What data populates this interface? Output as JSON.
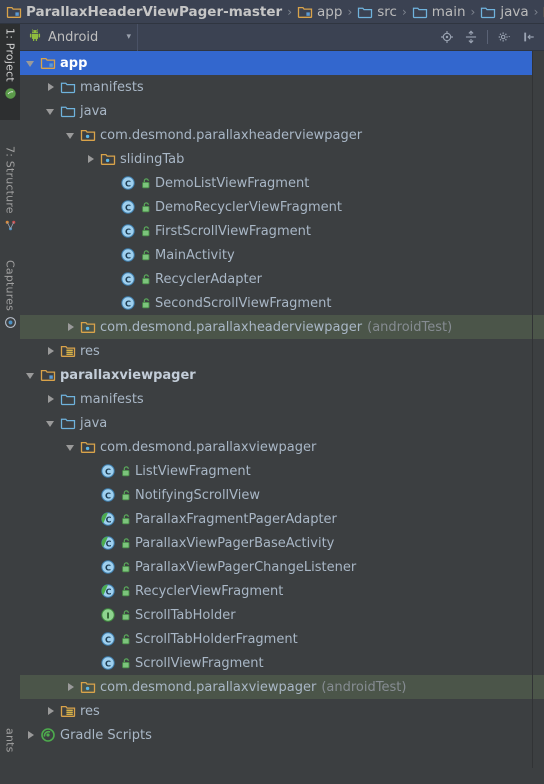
{
  "breadcrumb": {
    "items": [
      {
        "label": "ParallaxHeaderViewPager-master",
        "icon": "module-folder-icon"
      },
      {
        "label": "app",
        "icon": "module-folder-icon"
      },
      {
        "label": "src",
        "icon": "folder-icon"
      },
      {
        "label": "main",
        "icon": "folder-icon"
      },
      {
        "label": "java",
        "icon": "folder-icon"
      },
      {
        "label": "",
        "icon": "module-folder-icon"
      }
    ],
    "separator": "›"
  },
  "toolstrip": {
    "tabs": [
      {
        "label": "1: Project",
        "icon": "project-icon",
        "active": true
      },
      {
        "label": "7: Structure",
        "icon": "structure-icon",
        "active": false
      },
      {
        "label": "Captures",
        "icon": "captures-icon",
        "active": false
      },
      {
        "label": "ants",
        "icon": "variants-icon",
        "active": false
      }
    ]
  },
  "panel_toolbar": {
    "view_selector": {
      "label": "Android",
      "icon": "android-robot-icon",
      "caret": "▾"
    },
    "buttons": [
      {
        "name": "locate-target-icon",
        "title": "Select Opened File"
      },
      {
        "name": "collapse-all-icon",
        "title": "Collapse All"
      },
      {
        "name": "settings-gear-icon",
        "title": "Settings"
      },
      {
        "name": "hide-panel-icon",
        "title": "Hide"
      }
    ]
  },
  "colors": {
    "selection_blue": "#3367ce",
    "test_source_green": "#4b5549",
    "panel_background": "#3c3f41",
    "breadcrumb_background": "#3b4252",
    "text_primary": "#a9b7c6",
    "text_muted": "#868c92"
  },
  "tree": {
    "rows": [
      {
        "depth": 0,
        "arrow": "open",
        "icon": "module-folder-icon",
        "label": "app",
        "bold": true,
        "selected": true
      },
      {
        "depth": 1,
        "arrow": "closed",
        "icon": "folder-icon",
        "label": "manifests"
      },
      {
        "depth": 1,
        "arrow": "open",
        "icon": "folder-icon",
        "label": "java"
      },
      {
        "depth": 2,
        "arrow": "open",
        "icon": "package-folder-icon",
        "label": "com.desmond.parallaxheaderviewpager"
      },
      {
        "depth": 3,
        "arrow": "closed",
        "icon": "package-folder-icon",
        "label": "slidingTab"
      },
      {
        "depth": 4,
        "arrow": "none",
        "icon": "class-icon",
        "badge": "public-badge-icon",
        "label": "DemoListViewFragment"
      },
      {
        "depth": 4,
        "arrow": "none",
        "icon": "class-icon",
        "badge": "public-badge-icon",
        "label": "DemoRecyclerViewFragment"
      },
      {
        "depth": 4,
        "arrow": "none",
        "icon": "class-icon",
        "badge": "public-badge-icon",
        "label": "FirstScrollViewFragment"
      },
      {
        "depth": 4,
        "arrow": "none",
        "icon": "class-icon",
        "badge": "public-badge-icon",
        "label": "MainActivity"
      },
      {
        "depth": 4,
        "arrow": "none",
        "icon": "class-icon",
        "badge": "public-badge-icon",
        "label": "RecyclerAdapter"
      },
      {
        "depth": 4,
        "arrow": "none",
        "icon": "class-icon",
        "badge": "public-badge-icon",
        "label": "SecondScrollViewFragment"
      },
      {
        "depth": 2,
        "arrow": "closed",
        "icon": "package-folder-icon",
        "label": "com.desmond.parallaxheaderviewpager",
        "suffix": "(androidTest)",
        "testsrc": true
      },
      {
        "depth": 1,
        "arrow": "closed",
        "icon": "res-folder-icon",
        "label": "res"
      },
      {
        "depth": 0,
        "arrow": "open",
        "icon": "module-folder-icon",
        "label": "parallaxviewpager",
        "bold": true
      },
      {
        "depth": 1,
        "arrow": "closed",
        "icon": "folder-icon",
        "label": "manifests"
      },
      {
        "depth": 1,
        "arrow": "open",
        "icon": "folder-icon",
        "label": "java"
      },
      {
        "depth": 2,
        "arrow": "open",
        "icon": "package-folder-icon",
        "label": "com.desmond.parallaxviewpager"
      },
      {
        "depth": 3,
        "arrow": "none",
        "icon": "class-icon",
        "badge": "public-badge-icon",
        "label": "ListViewFragment"
      },
      {
        "depth": 3,
        "arrow": "none",
        "icon": "class-icon",
        "badge": "public-badge-icon",
        "label": "NotifyingScrollView"
      },
      {
        "depth": 3,
        "arrow": "none",
        "icon": "abstract-class-icon",
        "badge": "public-badge-icon",
        "label": "ParallaxFragmentPagerAdapter"
      },
      {
        "depth": 3,
        "arrow": "none",
        "icon": "abstract-class-icon",
        "badge": "public-badge-icon",
        "label": "ParallaxViewPagerBaseActivity"
      },
      {
        "depth": 3,
        "arrow": "none",
        "icon": "class-icon",
        "badge": "public-badge-icon",
        "label": "ParallaxViewPagerChangeListener"
      },
      {
        "depth": 3,
        "arrow": "none",
        "icon": "abstract-class-icon",
        "badge": "public-badge-icon",
        "label": "RecyclerViewFragment"
      },
      {
        "depth": 3,
        "arrow": "none",
        "icon": "interface-icon",
        "badge": "public-badge-icon",
        "label": "ScrollTabHolder"
      },
      {
        "depth": 3,
        "arrow": "none",
        "icon": "class-icon",
        "badge": "public-badge-icon",
        "label": "ScrollTabHolderFragment"
      },
      {
        "depth": 3,
        "arrow": "none",
        "icon": "class-icon",
        "badge": "public-badge-icon",
        "label": "ScrollViewFragment"
      },
      {
        "depth": 2,
        "arrow": "closed",
        "icon": "package-folder-icon",
        "label": "com.desmond.parallaxviewpager",
        "suffix": "(androidTest)",
        "testsrc": true
      },
      {
        "depth": 1,
        "arrow": "closed",
        "icon": "res-folder-icon",
        "label": "res"
      },
      {
        "depth": 0,
        "arrow": "closed",
        "icon": "gradle-icon",
        "label": "Gradle Scripts"
      }
    ]
  }
}
